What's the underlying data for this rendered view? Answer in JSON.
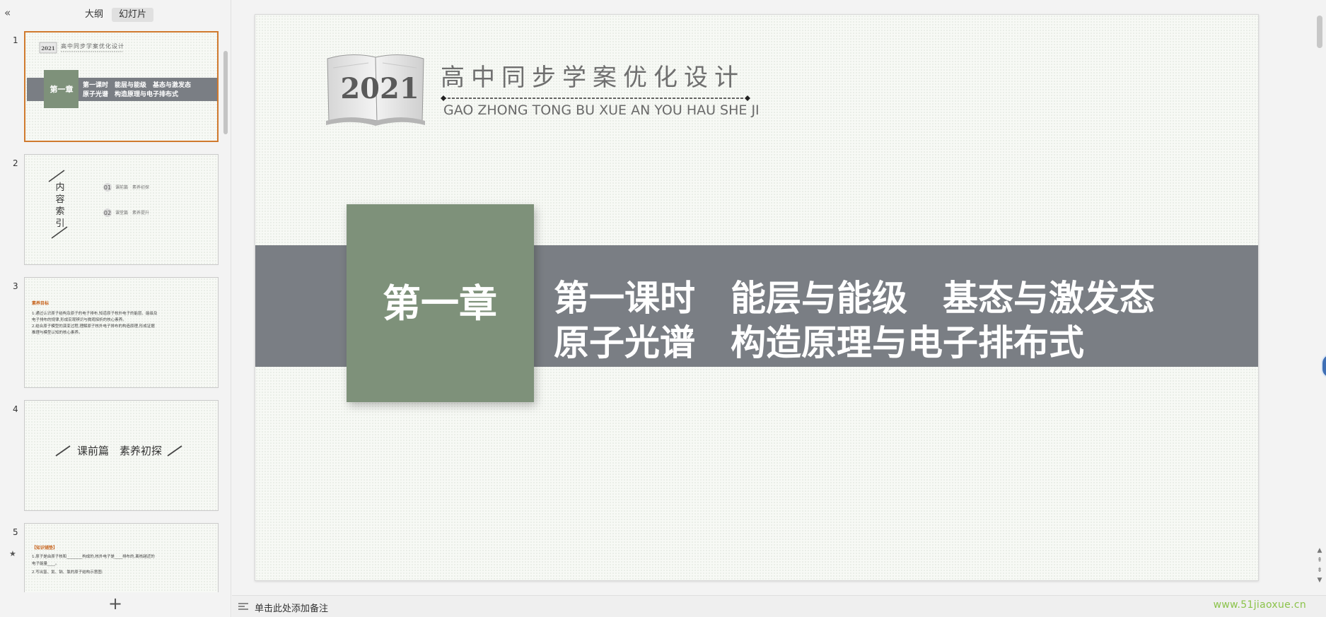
{
  "left_panel": {
    "tabs": {
      "outline": "大纲",
      "slides": "幻灯片"
    },
    "collapse_icon": "double-chevron-left-icon",
    "add_icon": "plus-icon",
    "thumbnails": [
      {
        "number": "1",
        "year": "2021",
        "title": "高中同步学案优化设计",
        "chapter": "第一章",
        "line1": "第一课时　能层与能级　基态与激发态",
        "line2": "原子光谱　构造原理与电子排布式"
      },
      {
        "number": "2",
        "vertical_title": [
          "内",
          "容",
          "索",
          "引"
        ],
        "items": [
          {
            "num": "01",
            "text": "课前篇　素养初探"
          },
          {
            "num": "02",
            "text": "课堂篇　素养提升"
          }
        ]
      },
      {
        "number": "3",
        "heading": "素养目标",
        "lines": [
          "1.通过认识原子结构及原子的电子排布,知道原子核外电子的能层、能级及",
          "电子排布的规律,形成宏观辨识与微观探析的核心素养。",
          "2.结合原子模型的演变过程,理解原子核外电子排布的构造原理,形成证据",
          "推理与模型认知的核心素养。"
        ]
      },
      {
        "number": "4",
        "text": "课前篇　素养初探"
      },
      {
        "number": "5",
        "heading": "【知识铺垫】",
        "lines": [
          "1.原子是由原子核和________构成的,核外电子是____排布的,离核越近的",
          "电子能量____。",
          "2.写出氢、氦、钠、氯的原子结构示意图:"
        ]
      }
    ]
  },
  "slide": {
    "year": "2021",
    "title": "高中同步学案优化设计",
    "pinyin": "GAO ZHONG TONG BU XUE AN YOU HAU SHE JI",
    "chapter": "第一章",
    "line1": "第一课时　能层与能级　基态与激发态",
    "line2": "原子光谱　构造原理与电子排布式",
    "colors": {
      "band": "#7a7e84",
      "chapter_box": "#7e917a",
      "background": "#f7f9f5"
    }
  },
  "notes_placeholder": "单击此处添加备注",
  "watermark": "www.51jiaoxue.cn"
}
